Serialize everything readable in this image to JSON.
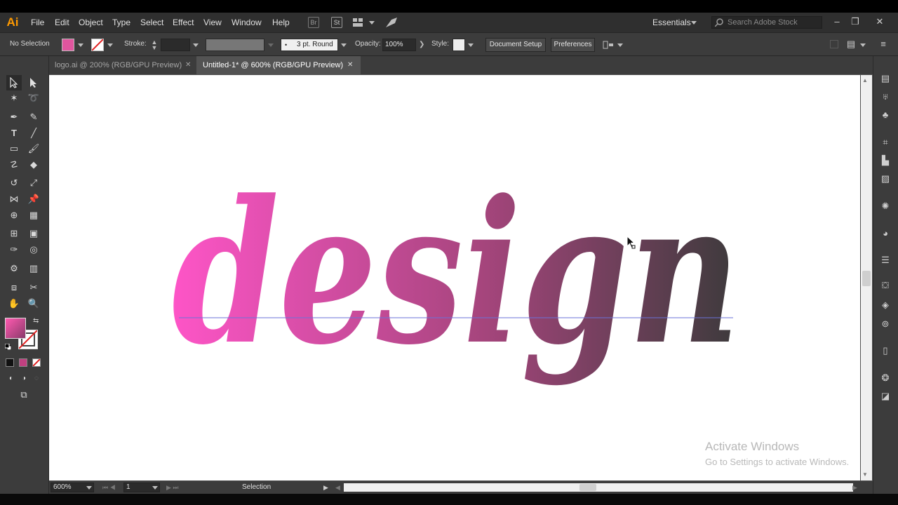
{
  "app": {
    "logo": "Ai"
  },
  "menu": [
    "File",
    "Edit",
    "Object",
    "Type",
    "Select",
    "Effect",
    "View",
    "Window",
    "Help"
  ],
  "topbar": {
    "bridge_icon": "Br",
    "stock_icon": "St",
    "workspace": "Essentials",
    "search_placeholder": "Search Adobe Stock"
  },
  "control": {
    "selection": "No Selection",
    "stroke_label": "Stroke:",
    "brush": "3 pt. Round",
    "opacity_label": "Opacity:",
    "opacity_value": "100%",
    "style_label": "Style:",
    "document_setup": "Document Setup",
    "preferences": "Preferences"
  },
  "tabs": [
    {
      "label": "logo.ai @ 200% (RGB/GPU Preview)",
      "active": false
    },
    {
      "label": "Untitled-1* @ 600% (RGB/GPU Preview)",
      "active": true
    }
  ],
  "artwork": {
    "text": "design",
    "gradient_start": "#ff55c8",
    "gradient_end": "#3a3a3a"
  },
  "status": {
    "zoom": "600%",
    "artboard": "1",
    "tool": "Selection"
  },
  "watermark": {
    "line1": "Activate Windows",
    "line2": "Go to Settings to activate Windows."
  },
  "colors": {
    "fill": "#e0559e"
  }
}
